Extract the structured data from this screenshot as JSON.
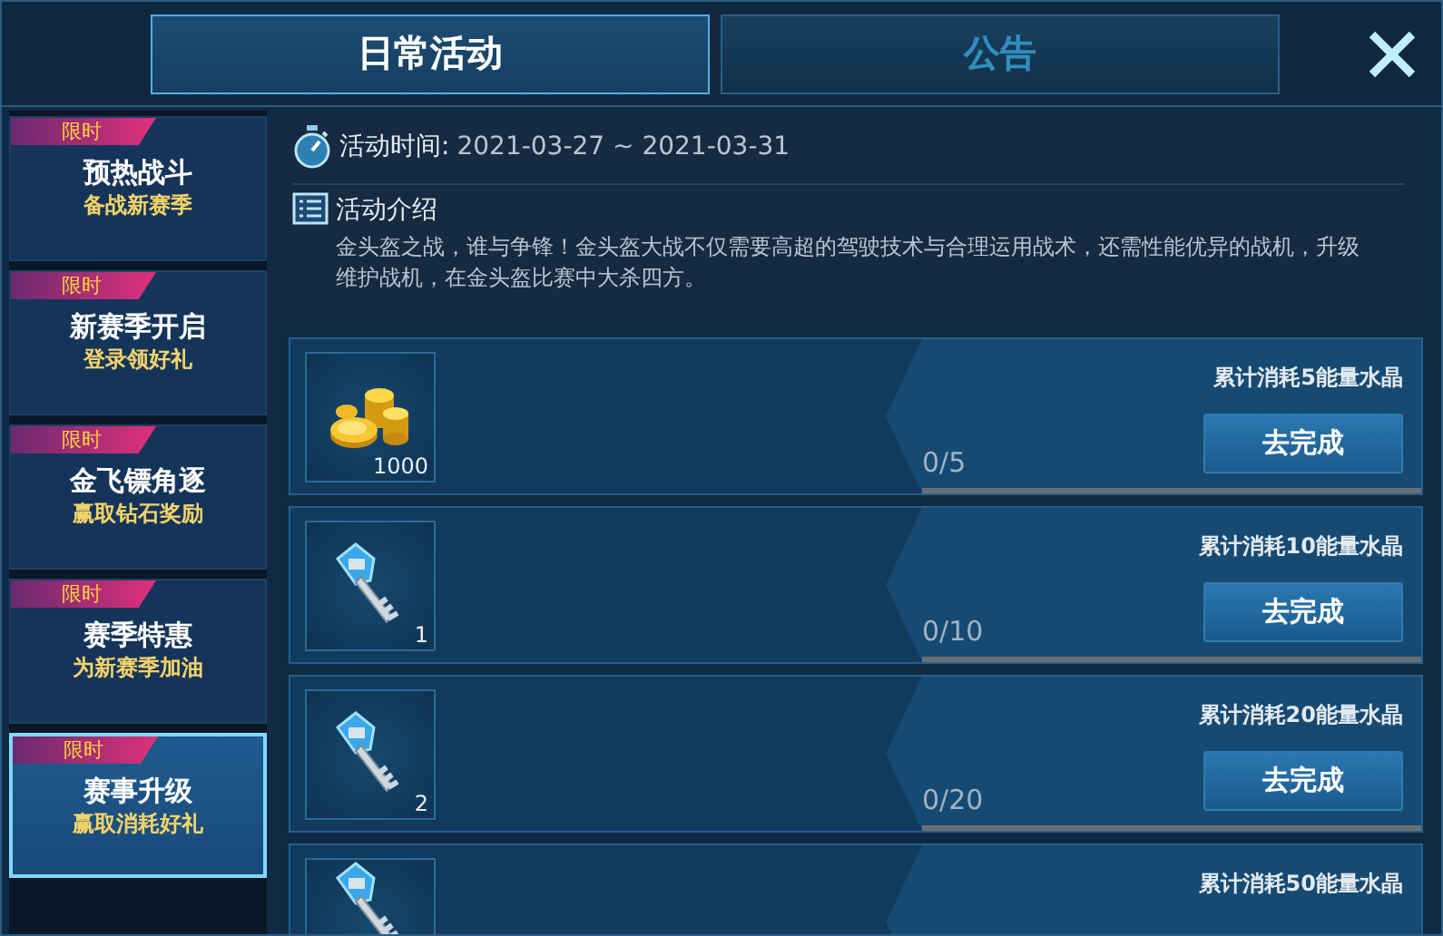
{
  "tabs": [
    {
      "label": "日常活动",
      "selected": true
    },
    {
      "label": "公告",
      "selected": false
    }
  ],
  "sidebar": {
    "items": [
      {
        "badge": "限时",
        "title": "预热战斗",
        "subtitle": "备战新赛季",
        "selected": false
      },
      {
        "badge": "限时",
        "title": "新赛季开启",
        "subtitle": "登录领好礼",
        "selected": false
      },
      {
        "badge": "限时",
        "title": "金飞镖角逐",
        "subtitle": "赢取钻石奖励",
        "selected": false
      },
      {
        "badge": "限时",
        "title": "赛季特惠",
        "subtitle": "为新赛季加油",
        "selected": false
      },
      {
        "badge": "限时",
        "title": "赛事升级",
        "subtitle": "赢取消耗好礼",
        "selected": true
      }
    ]
  },
  "info": {
    "time_label": "活动时间:",
    "time_value": "2021-03-27 ~ 2021-03-31",
    "intro_title": "活动介绍",
    "intro_text": "金头盔之战，谁与争锋！金头盔大战不仅需要高超的驾驶技术与合理运用战术，还需性能优异的战机，升级维护战机，在金头盔比赛中大杀四方。"
  },
  "tasks": [
    {
      "kind": "coins",
      "reward_count": "1000",
      "goal": "累计消耗5能量水晶",
      "progress": "0/5",
      "level": 0,
      "button": "去完成"
    },
    {
      "kind": "key",
      "reward_count": "1",
      "goal": "累计消耗10能量水晶",
      "progress": "0/10",
      "level": 0,
      "button": "去完成"
    },
    {
      "kind": "key",
      "reward_count": "2",
      "goal": "累计消耗20能量水晶",
      "progress": "0/20",
      "level": 0,
      "button": "去完成"
    },
    {
      "kind": "key",
      "goal": "累计消耗50能量水晶"
    }
  ]
}
